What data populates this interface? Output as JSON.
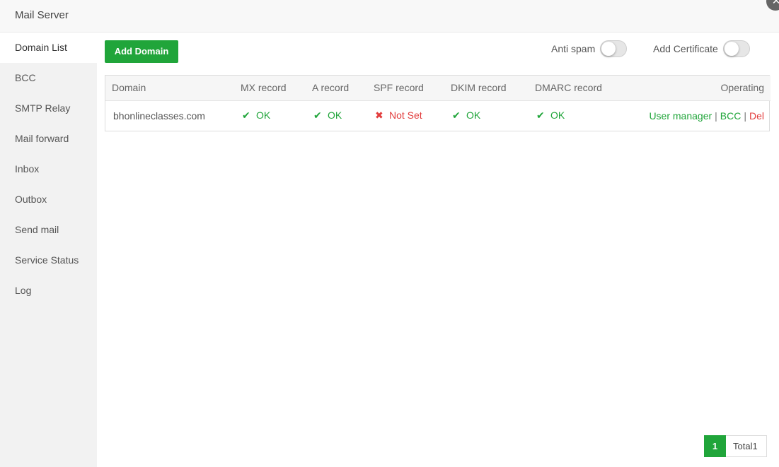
{
  "window": {
    "title": "Mail Server",
    "close_glyph": "✕"
  },
  "sidebar": {
    "items": [
      {
        "label": "Domain List",
        "active": true
      },
      {
        "label": "BCC"
      },
      {
        "label": "SMTP Relay"
      },
      {
        "label": "Mail forward"
      },
      {
        "label": "Inbox"
      },
      {
        "label": "Outbox"
      },
      {
        "label": "Send mail"
      },
      {
        "label": "Service Status"
      },
      {
        "label": "Log"
      }
    ]
  },
  "toolbar": {
    "add_domain_label": "Add Domain",
    "anti_spam_label": "Anti spam",
    "anti_spam_on": false,
    "add_certificate_label": "Add Certificate",
    "add_certificate_on": false
  },
  "table": {
    "columns": [
      "Domain",
      "MX record",
      "A record",
      "SPF record",
      "DKIM record",
      "DMARC record",
      "Operating"
    ],
    "rows": [
      {
        "domain": "bhonlineclasses.com",
        "mx": {
          "icon": "✔",
          "text": "OK",
          "status": "ok"
        },
        "a": {
          "icon": "✔",
          "text": "OK",
          "status": "ok"
        },
        "spf": {
          "icon": "✖",
          "text": "Not Set",
          "status": "error"
        },
        "dkim": {
          "icon": "✔",
          "text": "OK",
          "status": "ok"
        },
        "dmarc": {
          "icon": "✔",
          "text": "OK",
          "status": "ok"
        },
        "ops": {
          "user_manager": "User manager",
          "bcc": "BCC",
          "del": "Del",
          "separator": "|"
        }
      }
    ]
  },
  "pagination": {
    "current": "1",
    "total_label": "Total1"
  },
  "colors": {
    "accent": "#20a53a",
    "danger": "#e23c3c"
  }
}
